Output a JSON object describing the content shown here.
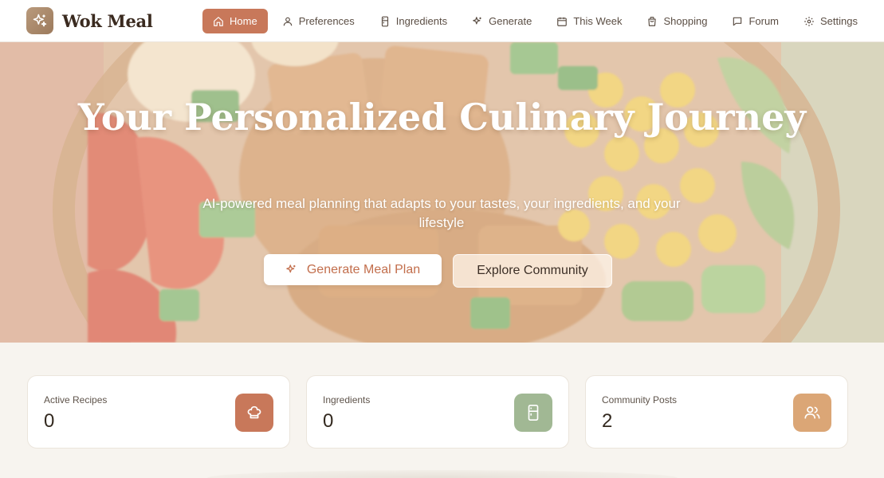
{
  "brand": {
    "name": "Wok Meal",
    "logo_icon": "sparkles-icon",
    "logo_color": "#a88a6c"
  },
  "nav": {
    "items": [
      {
        "label": "Home",
        "icon": "home-icon",
        "active": true
      },
      {
        "label": "Preferences",
        "icon": "user-icon",
        "active": false
      },
      {
        "label": "Ingredients",
        "icon": "fridge-icon",
        "active": false
      },
      {
        "label": "Generate",
        "icon": "sparkles-icon",
        "active": false
      },
      {
        "label": "This Week",
        "icon": "calendar-icon",
        "active": false
      },
      {
        "label": "Shopping",
        "icon": "shopping-bag-icon",
        "active": false
      },
      {
        "label": "Forum",
        "icon": "chat-icon",
        "active": false
      },
      {
        "label": "Settings",
        "icon": "gear-icon",
        "active": false
      }
    ],
    "active_color": "#c8785a"
  },
  "hero": {
    "title": "Your Personalized Culinary Journey",
    "subtitle": "AI-powered meal planning that adapts to your tastes, your ingredients, and your lifestyle",
    "primary_button": "Generate Meal Plan",
    "secondary_button": "Explore Community"
  },
  "stats": [
    {
      "label": "Active Recipes",
      "value": "0",
      "icon": "chef-hat-icon",
      "color": "#c8785a"
    },
    {
      "label": "Ingredients",
      "value": "0",
      "icon": "fridge-icon",
      "color": "#a1b894"
    },
    {
      "label": "Community Posts",
      "value": "2",
      "icon": "users-icon",
      "color": "#dba676"
    }
  ]
}
